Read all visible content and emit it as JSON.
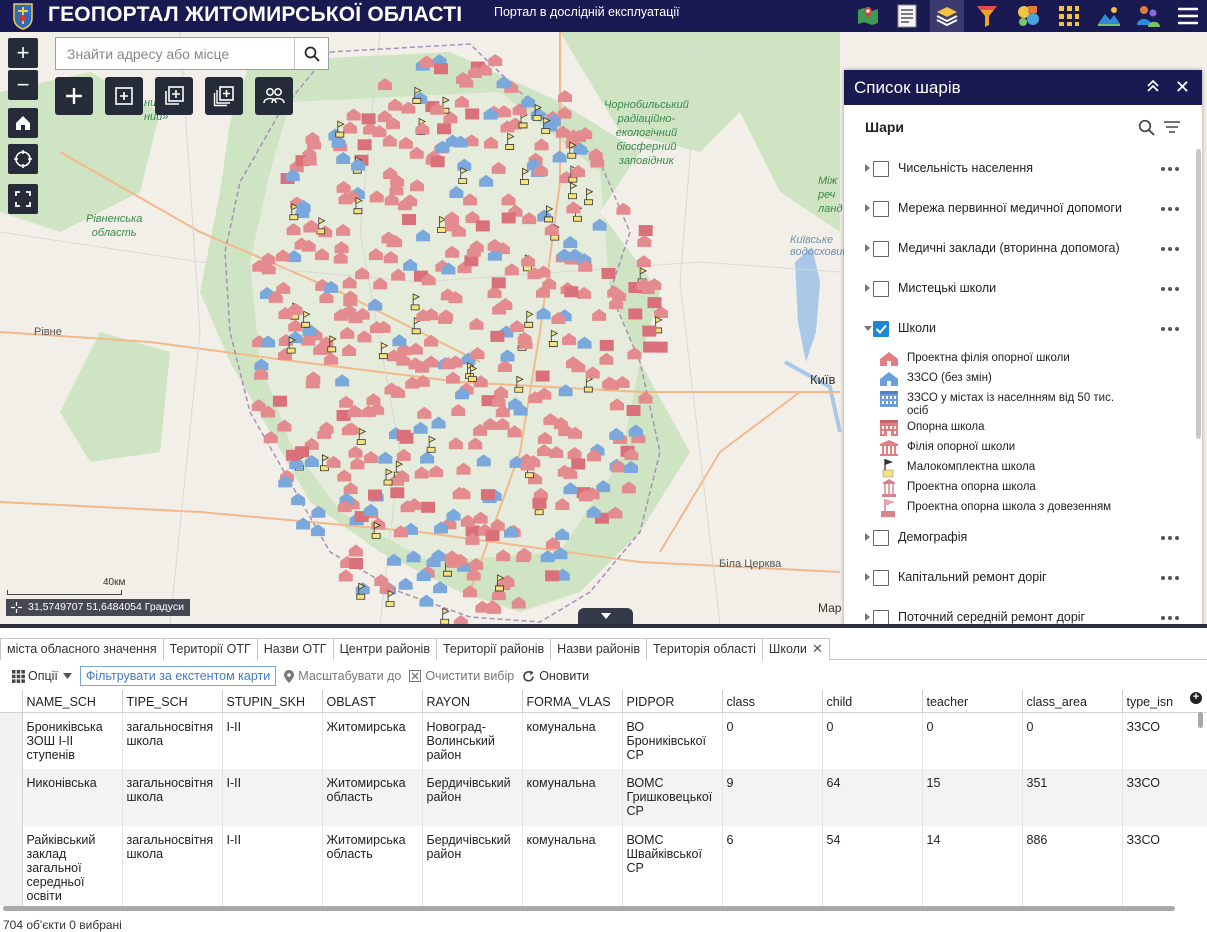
{
  "header": {
    "title": "ГЕОПОРТАЛ ЖИТОМИРСЬКОЇ ОБЛАСТІ",
    "subtitle": "Портал в дослідній експлуатації",
    "icons": [
      "map-icon",
      "list-icon",
      "layers-icon",
      "filter-icon",
      "analysis-icon",
      "grid-icon",
      "basemap-icon",
      "users-icon",
      "menu-icon"
    ]
  },
  "map": {
    "search_placeholder": "Знайти адресу або місце",
    "labels": {
      "chornobyl": "Чорнобильський\nрадіаційно-\nекологічний\nбіосферний\nзаповідник",
      "rivne_region": "Рівненська\nобласть",
      "rivne": "Рівне",
      "kyiv": "Київ",
      "bila_tserkva": "Біла Церква",
      "reservoir": "Київське\nводосховище",
      "mizh": "Між\nреч\nланд",
      "reserve_left": "ний\nний»"
    },
    "scale": "40км",
    "coords": "31,5749707 51,6484054 Градуси",
    "attribution": "Мар"
  },
  "layer_panel": {
    "title": "Список шарів",
    "subtitle": "Шари",
    "layers_top": [
      {
        "name": "Чисельність населення",
        "checked": false
      },
      {
        "name": "Мережа первинної медичної допомоги",
        "checked": false
      },
      {
        "name": "Медичні заклади (вторинна допомога)",
        "checked": false
      },
      {
        "name": "Мистецькі школи",
        "checked": false
      },
      {
        "name": "Школи",
        "checked": true
      }
    ],
    "legend": [
      {
        "label": "Проектна філія опорної школи",
        "symbol": "house-red"
      },
      {
        "label": "ЗЗСО (без змін)",
        "symbol": "house-blue"
      },
      {
        "label": "ЗЗСО у містах із населнням від 50 тис. осіб",
        "symbol": "building-blue"
      },
      {
        "label": "Опорна школа",
        "symbol": "building-red"
      },
      {
        "label": "Філія опорної школи",
        "symbol": "temple-red"
      },
      {
        "label": "Малокомплектна школа",
        "symbol": "flag-yellow"
      },
      {
        "label": "Проектна опорна школа",
        "symbol": "temple-pink"
      },
      {
        "label": "Проектна опорна школа з довезенням",
        "symbol": "flag-red"
      }
    ],
    "layers_bottom": [
      {
        "name": "Демографія",
        "checked": false
      },
      {
        "name": "Капітальний ремонт доріг",
        "checked": false
      },
      {
        "name": "Поточний середній ремонт доріг",
        "checked": false
      }
    ]
  },
  "table": {
    "tabs": [
      "міста обласного значення",
      "Території ОТГ",
      "Назви ОТГ",
      "Центри районів",
      "Території районів",
      "Назви районів",
      "Територія області",
      "Школи"
    ],
    "active_tab": "Школи",
    "toolbar": {
      "options": "Опції",
      "filter": "Фільтрувати за екстентом карти",
      "zoom": "Масштабувати до",
      "clear": "Очистити вибір",
      "refresh": "Оновити"
    },
    "columns": [
      "NAME_SCH",
      "TIPE_SCH",
      "STUPIN_SKH",
      "OBLAST",
      "RAYON",
      "FORMA_VLAS",
      "PIDPOR",
      "class",
      "child",
      "teacher",
      "class_area",
      "type_isn"
    ],
    "rows": [
      [
        "Брониківська ЗОШ І-ІІ ступенів",
        "загальносвітня школа",
        "І-ІІ",
        "Житомирська",
        "Новоград-Волинський район",
        "комунальна",
        "ВО Брониківської СР",
        "0",
        "0",
        "0",
        "0",
        "ЗЗСО"
      ],
      [
        "Никонівська",
        "загальносвітня школа",
        "І-ІІ",
        "Житомирська область",
        "Бердичівський район",
        "комунальна",
        "ВОМС Гришковецької СР",
        "9",
        "64",
        "15",
        "351",
        "ЗЗСО"
      ],
      [
        "Райківський заклад загальної середньої освіти",
        "загальносвітня школа",
        "І-ІІ",
        "Житомирська область",
        "Бердичівський район",
        "комунальна",
        "ВОМС Швайківської СР",
        "6",
        "54",
        "14",
        "886",
        "ЗЗСО"
      ]
    ],
    "status": "704 об'єкти 0 вибрані"
  }
}
